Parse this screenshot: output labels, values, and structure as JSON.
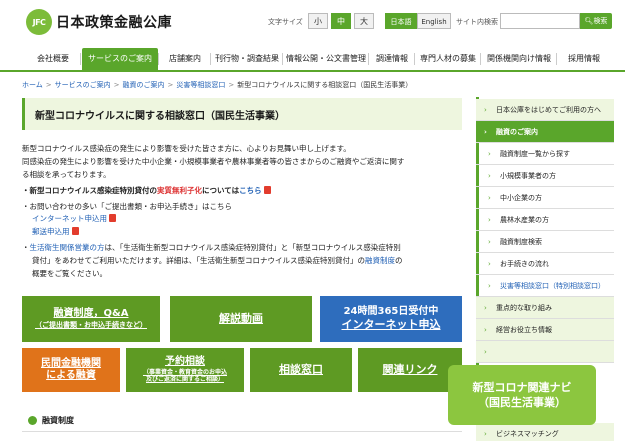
{
  "header": {
    "logo_mark": "JFC",
    "logo_text": "日本政策金融公庫",
    "font_size_label": "文字サイズ",
    "font_sizes": [
      "小",
      "中",
      "大"
    ],
    "languages": [
      "日本語",
      "English"
    ],
    "search_label": "サイト内検索",
    "search_placeholder": "",
    "search_button": "検索"
  },
  "nav": {
    "items": [
      "会社概要",
      "サービスのご案内",
      "店舗案内",
      "刊行物・調査結果",
      "情報公開・公文書管理",
      "調達情報",
      "専門人材の募集",
      "関係機関向け情報",
      "採用情報"
    ],
    "active_index": 1
  },
  "breadcrumb": {
    "items": [
      "ホーム",
      "サービスのご案内",
      "融資のご案内",
      "災害等相談窓口"
    ],
    "current": "新型コロナウイルスに関する相談窓口（国民生活事業）",
    "separator": ">"
  },
  "main": {
    "title": "新型コロナウイルスに関する相談窓口（国民生活事業）",
    "para1": "新型コロナウイルス感染症の発生により影響を受けた皆さま方に、心よりお見舞い申し上げます。",
    "para2a": "同感染症の発生により影響を受けた中小企業・小規模事業者や農林事業者等の皆さまからのご融資やご返済に関す",
    "para2b": "る相談を承っております。",
    "b1_pre": "・新型コロナウイルス感染症特別貸付の",
    "b1_red": "実質無利子化",
    "b1_mid": "については",
    "b1_link": "こちら",
    "b2": "・お問い合わせの多い「ご提出書類・お申込手続き」はこちら",
    "b2_link1": "インターネット申込用",
    "b2_link2": "郵送申込用",
    "b3_link": "生活衛生関係営業の方",
    "b3_a": "は、「生活衛生新型コロナウイルス感染症特別貸付」と「新型コロナウイルス感染症特別",
    "b3_b": "貸付」をあわせてご利用いただけます。詳細は、「生活衛生新型コロナウイルス感染症特別貸付」の",
    "b3_link2": "融資制度",
    "b3_c": "の",
    "b3_d": "概要をご覧ください。"
  },
  "tiles": {
    "t1_l1": "融資制度，Q&A",
    "t1_l2": "（ご提出書類・お申込手続きなど）",
    "t2": "解説動画",
    "t3_l1": "24時間365日受付中",
    "t3_l2": "インターネット申込",
    "t4_l1": "民間金融機関",
    "t4_l2": "による融資",
    "t5_l1": "予約相談",
    "t5_l2": "（事業資金・教育資金のお申込",
    "t5_l3": "及びご返済に関するご相談）",
    "t6": "相談窓口",
    "t7": "関連リンク",
    "navi_l1": "新型コロナ関連ナビ",
    "navi_l2": "（国民生活事業）"
  },
  "section": {
    "label": "融資制度"
  },
  "sidebar": {
    "items": [
      {
        "label": "日本公庫をはじめてご利用の方へ",
        "kind": "head"
      },
      {
        "label": "融資のご案内",
        "kind": "cur"
      },
      {
        "label": "融資制度一覧から探す",
        "kind": "sub"
      },
      {
        "label": "小規模事業者の方",
        "kind": "sub"
      },
      {
        "label": "中小企業の方",
        "kind": "sub"
      },
      {
        "label": "農林水産業の方",
        "kind": "sub"
      },
      {
        "label": "融資制度検索",
        "kind": "sub"
      },
      {
        "label": "お手続きの流れ",
        "kind": "sub"
      },
      {
        "label": "災害等相談窓口（特別相談窓口）",
        "kind": "sublink"
      },
      {
        "label": "重点的な取り組み",
        "kind": "head"
      },
      {
        "label": "経営お役立ち情報",
        "kind": "head"
      },
      {
        "label": "",
        "kind": "head"
      },
      {
        "label": "ビジネスマッチング",
        "kind": "head"
      }
    ]
  },
  "colors": {
    "brand_green": "#5aa62b",
    "tile_blue": "#2e6dbd",
    "tile_orange": "#e0731a",
    "navi_green": "#8cc63f"
  }
}
